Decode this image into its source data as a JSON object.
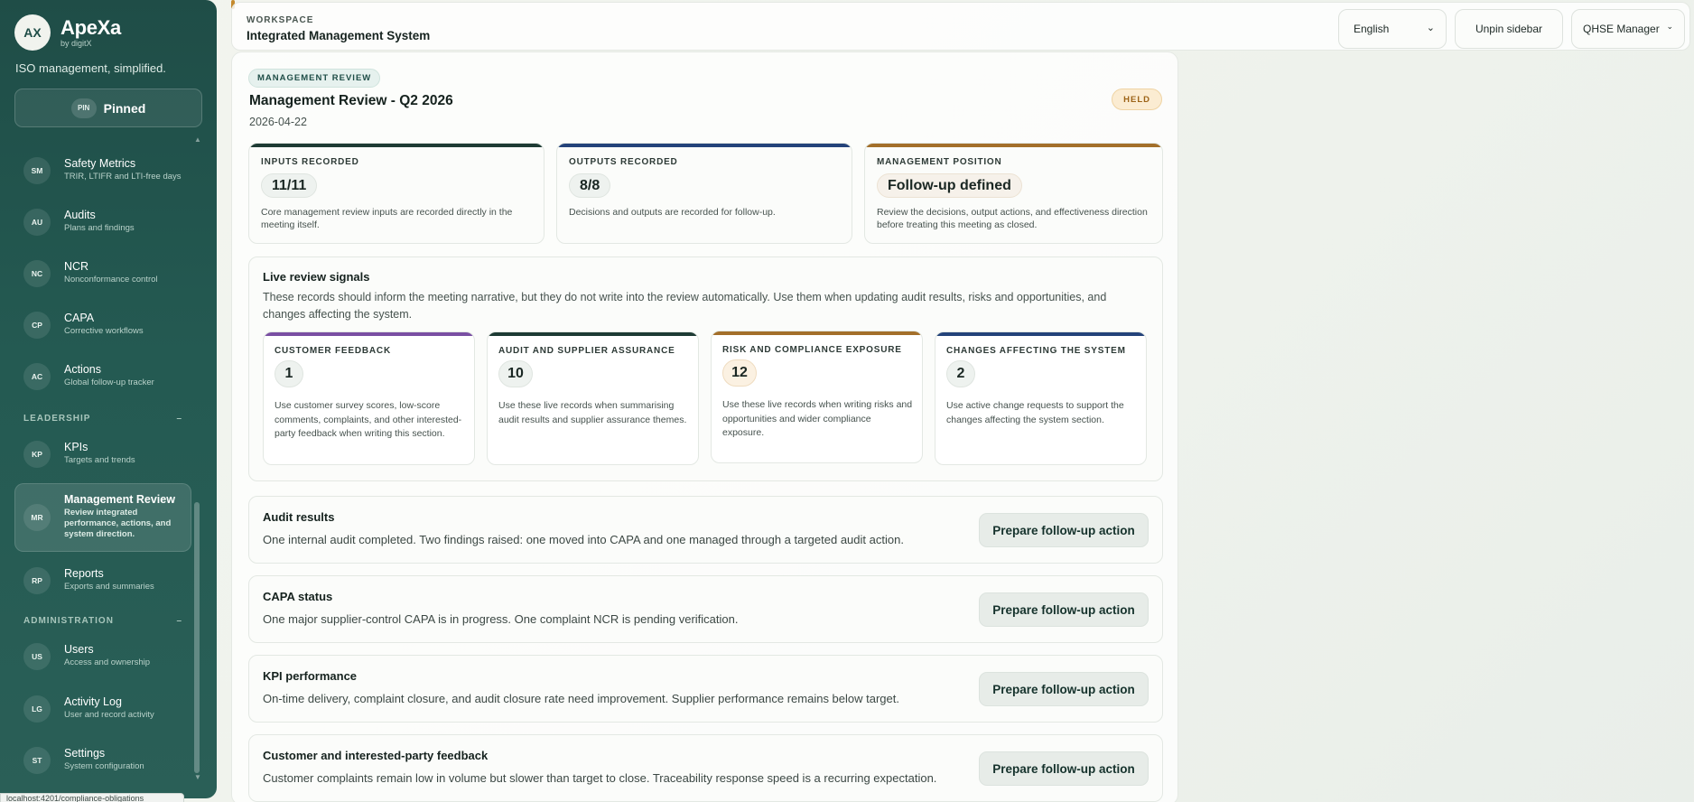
{
  "brand": {
    "initials": "AX",
    "name": "ApeXa",
    "by": "by digitX",
    "tagline": "ISO management, simplified."
  },
  "pin": {
    "badge": "PIN",
    "label": "Pinned"
  },
  "nav": {
    "items": [
      {
        "code": "SM",
        "title": "Safety Metrics",
        "sub": "TRIR, LTIFR and LTI-free days"
      },
      {
        "code": "AU",
        "title": "Audits",
        "sub": "Plans and findings"
      },
      {
        "code": "NC",
        "title": "NCR",
        "sub": "Nonconformance control"
      },
      {
        "code": "CP",
        "title": "CAPA",
        "sub": "Corrective workflows"
      },
      {
        "code": "AC",
        "title": "Actions",
        "sub": "Global follow-up tracker"
      },
      {
        "code": "KP",
        "title": "KPIs",
        "sub": "Targets and trends"
      },
      {
        "code": "MR",
        "title": "Management Review",
        "sub": "Review integrated performance, actions, and system direction."
      },
      {
        "code": "RP",
        "title": "Reports",
        "sub": "Exports and summaries"
      },
      {
        "code": "US",
        "title": "Users",
        "sub": "Access and ownership"
      },
      {
        "code": "LG",
        "title": "Activity Log",
        "sub": "User and record activity"
      },
      {
        "code": "ST",
        "title": "Settings",
        "sub": "System configuration"
      }
    ],
    "sections": [
      {
        "label": "LEADERSHIP",
        "toggle": "–"
      },
      {
        "label": "ADMINISTRATION",
        "toggle": "–"
      }
    ]
  },
  "url_status": "localhost:4201/compliance-obligations",
  "header": {
    "eyebrow": "WORKSPACE",
    "title": "Integrated Management System",
    "language": "English",
    "unpin": "Unpin sidebar",
    "role": "QHSE Manager"
  },
  "review": {
    "eyebrow": "MANAGEMENT REVIEW",
    "title": "Management Review - Q2 2026",
    "date": "2026-04-22",
    "status": "HELD",
    "stats": [
      {
        "label": "INPUTS RECORDED",
        "value": "11/11",
        "desc": "Core management review inputs are recorded directly in the meeting itself.",
        "color": "#1e3b34"
      },
      {
        "label": "OUTPUTS RECORDED",
        "value": "8/8",
        "desc": "Decisions and outputs are recorded for follow-up.",
        "color": "#24437a"
      },
      {
        "label": "MANAGEMENT POSITION",
        "value": "Follow-up defined",
        "desc": "Review the decisions, output actions, and effectiveness direction before treating this meeting as closed.",
        "color": "#a36f2a"
      }
    ],
    "signals": {
      "title": "Live review signals",
      "desc": "These records should inform the meeting narrative, but they do not write into the review automatically. Use them when updating audit results, risks and opportunities, and changes affecting the system.",
      "cards": [
        {
          "label": "CUSTOMER FEEDBACK",
          "count": "1",
          "desc": "Use customer survey scores, low-score comments, complaints, and other interested-party feedback when writing this section.",
          "color": "#7a4fa3"
        },
        {
          "label": "AUDIT AND SUPPLIER ASSURANCE",
          "count": "10",
          "desc": "Use these live records when summarising audit results and supplier assurance themes.",
          "color": "#1e3b34"
        },
        {
          "label": "RISK AND COMPLIANCE EXPOSURE",
          "count": "12",
          "desc": "Use these live records when writing risks and opportunities and wider compliance exposure.",
          "color": "#a36f2a"
        },
        {
          "label": "CHANGES AFFECTING THE SYSTEM",
          "count": "2",
          "desc": "Use active change requests to support the changes affecting the system section.",
          "color": "#24437a"
        }
      ]
    },
    "rows": [
      {
        "title": "Audit results",
        "desc": "One internal audit completed. Two findings raised: one moved into CAPA and one managed through a targeted audit action.",
        "button": "Prepare follow-up action"
      },
      {
        "title": "CAPA status",
        "desc": "One major supplier-control CAPA is in progress. One complaint NCR is pending verification.",
        "button": "Prepare follow-up action"
      },
      {
        "title": "KPI performance",
        "desc": "On-time delivery, complaint closure, and audit closure rate need improvement. Supplier performance remains below target.",
        "button": "Prepare follow-up action"
      },
      {
        "title": "Customer and interested-party feedback",
        "desc": "Customer complaints remain low in volume but slower than target to close. Traceability response speed is a recurring expectation.",
        "button": "Prepare follow-up action"
      }
    ]
  }
}
